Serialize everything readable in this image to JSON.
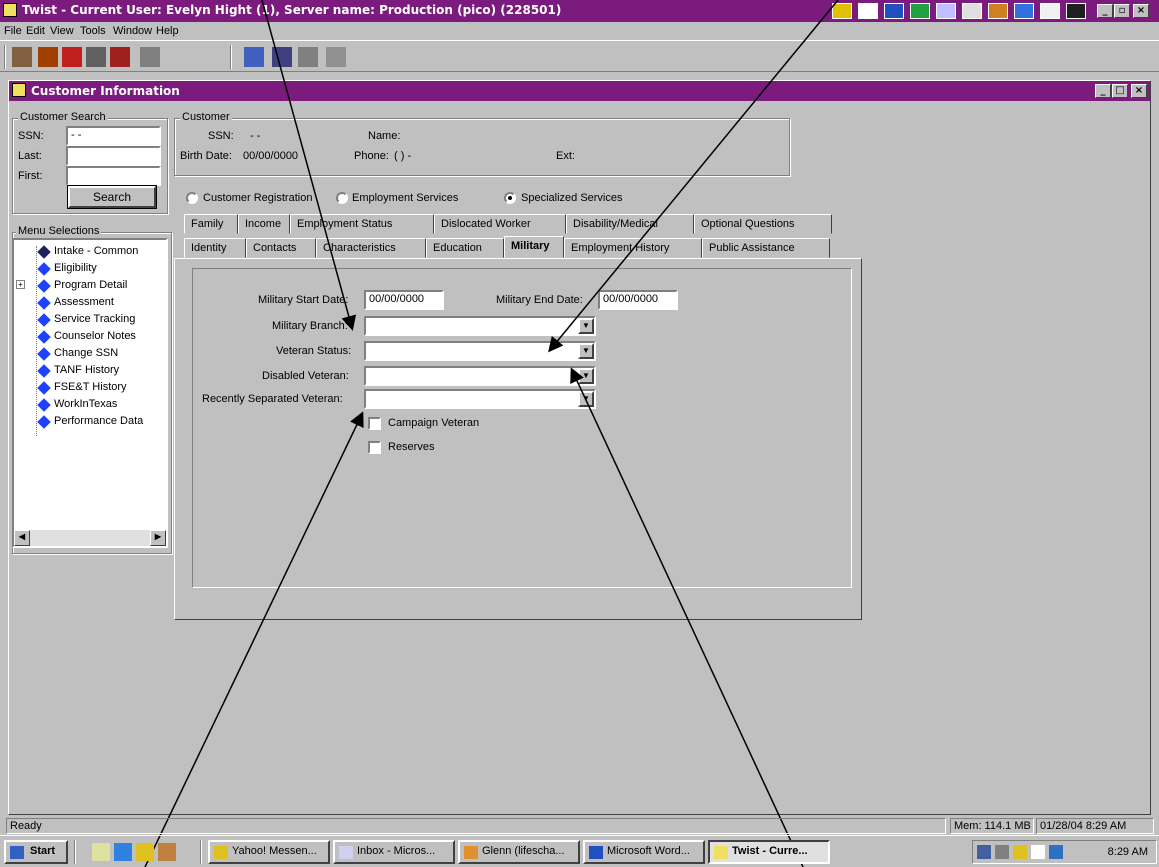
{
  "window": {
    "title": "Twist - Current User: Evelyn Hight (1), Server name: Production (pico) (228501)"
  },
  "menu": [
    "File",
    "Edit",
    "View",
    "Tools",
    "Window",
    "Help"
  ],
  "child": {
    "title": "Customer Information"
  },
  "search": {
    "group_label": "Customer Search",
    "ssn_label": "SSN:",
    "ssn_value": " -  -",
    "last_label": "Last:",
    "last_value": "",
    "first_label": "First:",
    "first_value": "",
    "button": "Search"
  },
  "customer": {
    "group_label": "Customer",
    "ssn_label": "SSN:",
    "ssn_value": "-  -",
    "name_label": "Name:",
    "birth_label": "Birth Date:",
    "birth_value": "00/00/0000",
    "phone_label": "Phone:",
    "phone_value": "(   )   -",
    "ext_label": "Ext:"
  },
  "modes": {
    "options": [
      "Customer Registration",
      "Employment Services",
      "Specialized Services"
    ],
    "selected": "Specialized Services"
  },
  "menu_selections": {
    "label": "Menu Selections",
    "items": [
      "Intake - Common",
      "Eligibility",
      "Program Detail",
      "Assessment",
      "Service Tracking",
      "Counselor Notes",
      "Change SSN",
      "TANF History",
      "FSE&T History",
      "WorkInTexas",
      "Performance Data"
    ]
  },
  "tabs": {
    "row1": [
      "Family",
      "Income",
      "Employment Status",
      "Dislocated Worker",
      "Disability/Medical",
      "Optional Questions"
    ],
    "row2": [
      "Identity",
      "Contacts",
      "Characteristics",
      "Education",
      "Military",
      "Employment History",
      "Public Assistance"
    ],
    "active": "Military"
  },
  "military": {
    "start_label": "Military Start Date:",
    "start_value": "00/00/0000",
    "end_label": "Military End Date:",
    "end_value": "00/00/0000",
    "branch_label": "Military Branch:",
    "branch_value": "",
    "veteran_label": "Veteran Status:",
    "veteran_value": "",
    "disabled_label": "Disabled Veteran:",
    "disabled_value": "",
    "separated_label": "Recently Separated Veteran:",
    "separated_value": "",
    "campaign_label": "Campaign Veteran",
    "campaign_checked": false,
    "reserves_label": "Reserves",
    "reserves_checked": false
  },
  "status": {
    "text": "Ready",
    "memory": "Mem: 114.1 MB",
    "datetime": "01/28/04 8:29 AM"
  },
  "taskbar": {
    "start": "Start",
    "tasks": [
      "Yahoo! Messen...",
      "Inbox - Micros...",
      "Glenn (lifescha...",
      "Microsoft Word...",
      "Twist - Curre..."
    ],
    "active_task": "Twist - Curre...",
    "clock": "8:29 AM"
  }
}
